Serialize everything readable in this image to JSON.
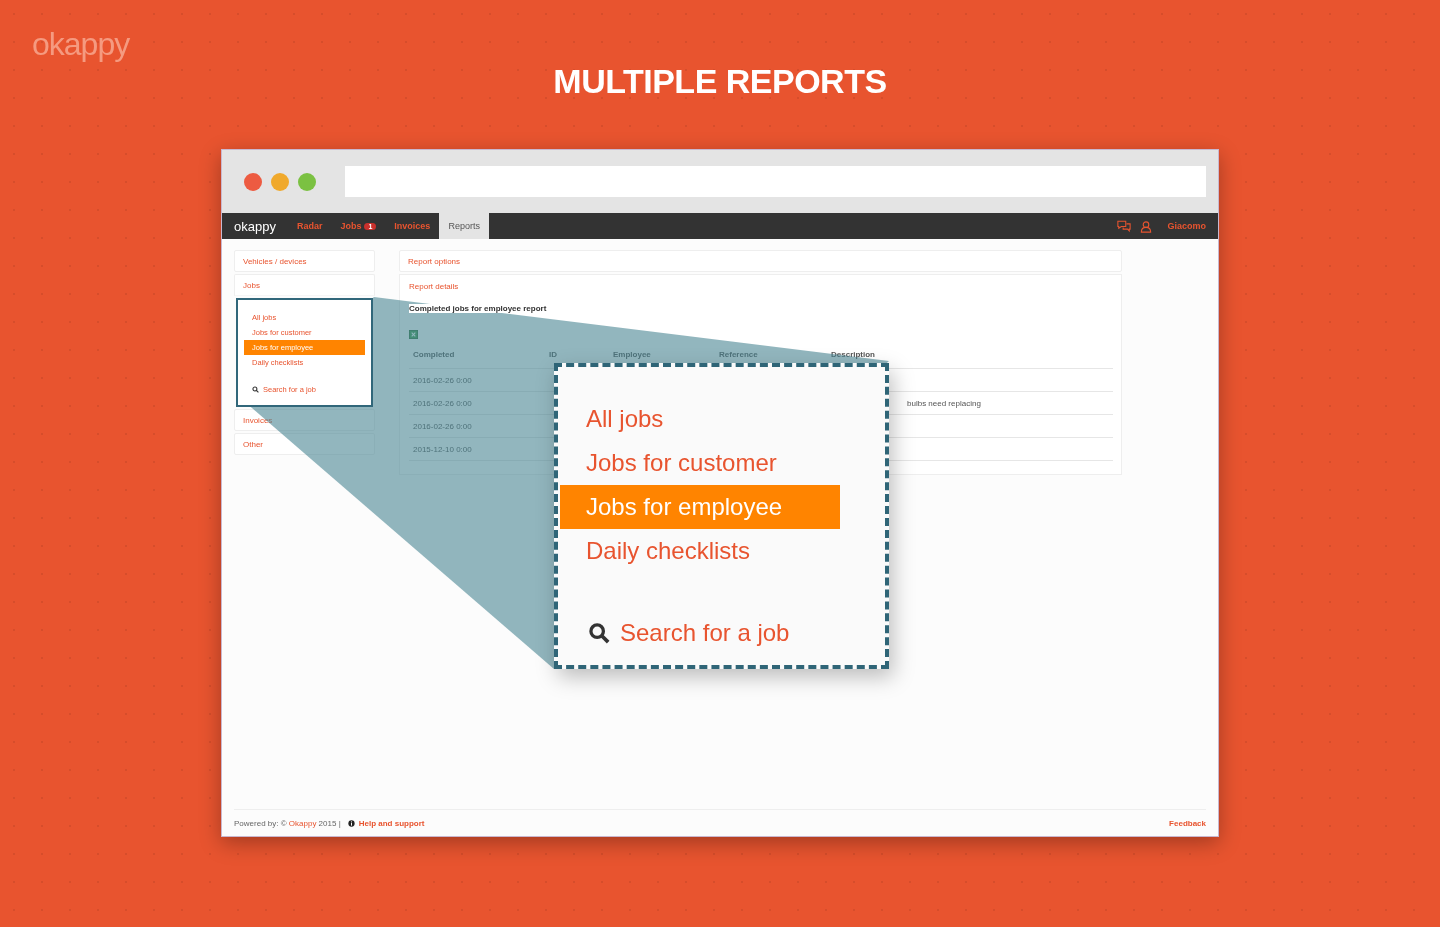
{
  "brand_logo": "okappy",
  "heading": "MULTIPLE REPORTS",
  "nav": {
    "logo": "okappy",
    "tabs": [
      {
        "label": "Radar",
        "selected": false
      },
      {
        "label": "Jobs",
        "badge": "1",
        "selected": false
      },
      {
        "label": "Invoices",
        "selected": false
      },
      {
        "label": "Reports",
        "selected": true
      }
    ],
    "user": "Giacomo"
  },
  "sidebar": {
    "sections": [
      {
        "label": "Vehicles / devices"
      },
      {
        "label": "Jobs",
        "items": [
          {
            "label": "All jobs",
            "kind": "link",
            "selected": false
          },
          {
            "label": "Jobs for customer",
            "kind": "link",
            "selected": false
          },
          {
            "label": "Jobs for employee",
            "kind": "link",
            "selected": true
          },
          {
            "label": "Daily checklists",
            "kind": "link",
            "selected": false
          },
          {
            "label": "Search for a job",
            "kind": "search",
            "selected": false
          }
        ]
      },
      {
        "label": "Invoices"
      },
      {
        "label": "Other"
      }
    ]
  },
  "main": {
    "panels": [
      "Report options",
      "Report details"
    ],
    "report_title": "Completed jobs for employee report",
    "table": {
      "columns": [
        "Completed",
        "ID",
        "Employee",
        "Reference",
        "Description"
      ],
      "rows": [
        {
          "completed": "2016-02-26 0:00"
        },
        {
          "completed": "2016-02-26 0:00",
          "description": "bulbs need replacing"
        },
        {
          "completed": "2016-02-26 0:00"
        },
        {
          "completed": "2015-12-10 0:00"
        }
      ]
    }
  },
  "zoom": {
    "items": [
      {
        "label": "All jobs",
        "kind": "link",
        "selected": false
      },
      {
        "label": "Jobs for customer",
        "kind": "link",
        "selected": false
      },
      {
        "label": "Jobs for employee",
        "kind": "link",
        "selected": true
      },
      {
        "label": "Daily checklists",
        "kind": "link",
        "selected": false
      },
      {
        "label": "Search for a job",
        "kind": "search",
        "selected": false
      }
    ]
  },
  "footer": {
    "powered_prefix": "Powered by: ©",
    "brand_link": "Okappy",
    "powered_suffix": "2015 |",
    "help_link": "Help and support",
    "feedback_link": "Feedback"
  }
}
